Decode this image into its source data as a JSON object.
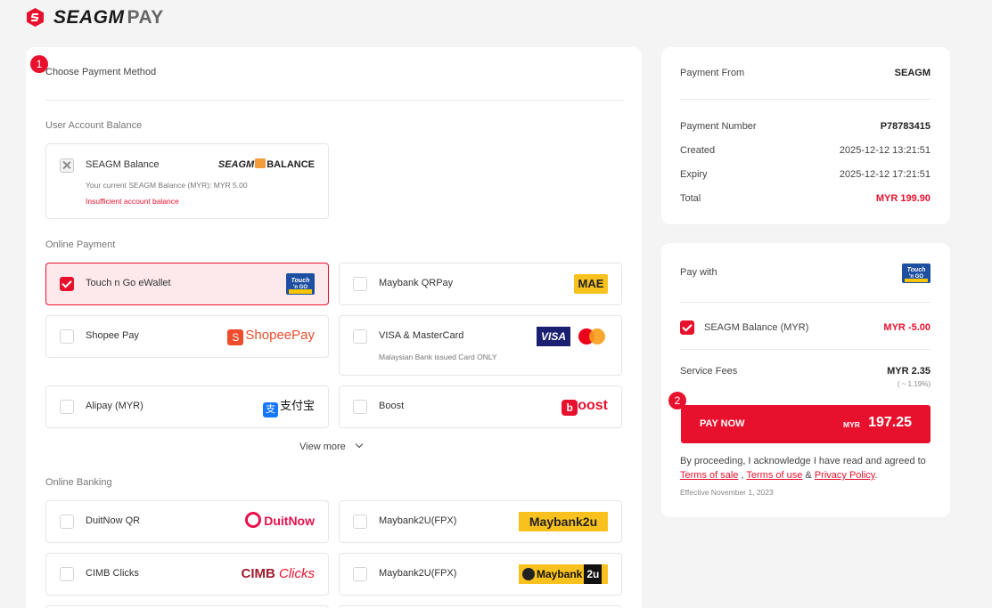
{
  "header": {
    "brand": "SEAGM",
    "pay": "PAY"
  },
  "steps": [
    "1",
    "2"
  ],
  "method": {
    "title": "Choose Payment Method",
    "account_section": "User Account Balance",
    "balance": {
      "label": "SEAGM Balance",
      "logo_brand": "SEAGM",
      "logo_word": "BALANCE",
      "note": "Your current SEAGM Balance (MYR): MYR 5.00",
      "error": "Insufficient account balance"
    },
    "online_section": "Online Payment",
    "online": [
      {
        "label": "Touch n Go eWallet",
        "selected": true,
        "logo": "tng-logo"
      },
      {
        "label": "Maybank QRPay",
        "selected": false,
        "logo": "mae-logo",
        "logo_text": "MAE"
      },
      {
        "label": "Shopee Pay",
        "selected": false,
        "logo": "shopeepay-logo",
        "logo_text": "ShopeePay"
      },
      {
        "label": "VISA & MasterCard",
        "selected": false,
        "logo": "visa-mastercard-logo",
        "logo_text": "VISA",
        "note": "Malaysian Bank issued Card ONLY"
      },
      {
        "label": "Alipay (MYR)",
        "selected": false,
        "logo": "alipay-logo",
        "logo_text": "支付宝"
      },
      {
        "label": "Boost",
        "selected": false,
        "logo": "boost-logo",
        "logo_text": "oost"
      }
    ],
    "view_more": "View more",
    "banking_section": "Online Banking",
    "banking": [
      {
        "label": "DuitNow QR",
        "logo": "duitnow-logo",
        "logo_text": "DuitNow"
      },
      {
        "label": "Maybank2U(FPX)",
        "logo": "maybank2u-logo",
        "logo_text": "Maybank2u"
      },
      {
        "label": "CIMB Clicks",
        "logo": "cimb-clicks-logo",
        "logo_text": "CIMB",
        "logo_text2": "Clicks"
      },
      {
        "label": "Maybank2U(FPX)",
        "logo": "maybank2u-dark-logo",
        "logo_text": "Maybank",
        "logo_text2": "2u"
      }
    ]
  },
  "summary": {
    "payment_from_label": "Payment From",
    "payment_from_value": "SEAGM",
    "number_label": "Payment Number",
    "number_value": "P78783415",
    "created_label": "Created",
    "created_value": "2025-12-12 13:21:51",
    "expiry_label": "Expiry",
    "expiry_value": "2025-12-12 17:21:51",
    "total_label": "Total",
    "total_value": "MYR 199.90"
  },
  "paywith": {
    "title": "Pay with",
    "balance_label": "SEAGM Balance (MYR)",
    "balance_value": "MYR -5.00",
    "fees_label": "Service Fees",
    "fees_value": "MYR 2.35",
    "fees_pct": "( ~ 1.19%)",
    "button_label": "PAY NOW",
    "button_currency": "MYR",
    "button_amount": "197.25",
    "terms_text": "By proceeding, I acknowledge I have read and agreed to",
    "terms_sale": "Terms of sale",
    "terms_use": "Terms of use",
    "privacy": "Privacy Policy",
    "effective": "Effective November 1, 2023"
  },
  "colors": {
    "accent": "#e8112d",
    "background": "#f4f4f4"
  }
}
